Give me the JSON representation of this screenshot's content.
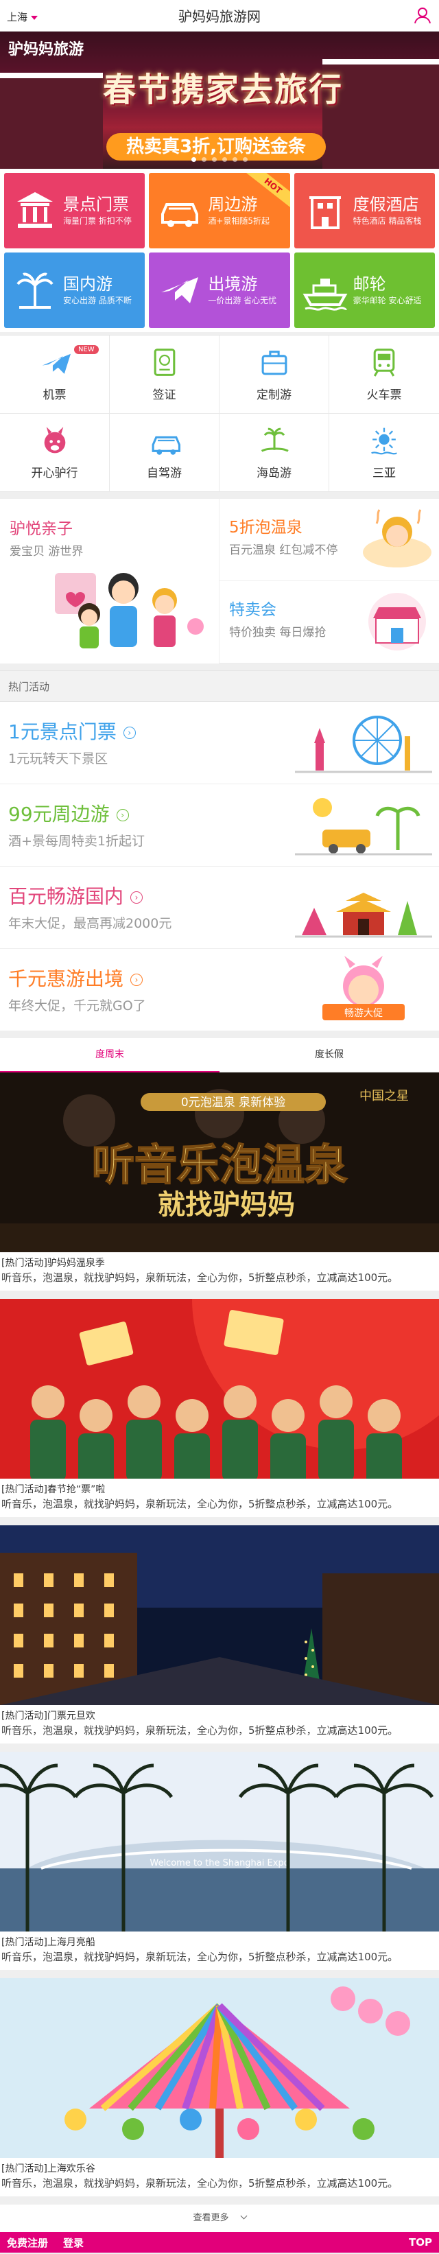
{
  "header": {
    "city": "上海",
    "title": "驴妈妈旅游网"
  },
  "banner": {
    "logo": "驴妈妈旅游",
    "headline": "春节携家去旅行",
    "ribbon": "热卖真3折,订购送金条"
  },
  "tiles": [
    {
      "title": "景点门票",
      "sub": "海量门票 折扣不停",
      "color": "#e93e68",
      "icon": "temple-icon"
    },
    {
      "title": "周边游",
      "sub": "酒+景相随5折起",
      "color": "#ff7d26",
      "icon": "car-icon",
      "badge": "HOT"
    },
    {
      "title": "度假酒店",
      "sub": "特色酒店 精品客栈",
      "color": "#f0554b",
      "icon": "hotel-icon"
    },
    {
      "title": "国内游",
      "sub": "安心出游 品质不断",
      "color": "#3f9ae6",
      "icon": "palm-icon"
    },
    {
      "title": "出境游",
      "sub": "一价出游 省心无忧",
      "color": "#b352d8",
      "icon": "plane-icon"
    },
    {
      "title": "邮轮",
      "sub": "豪华邮轮 安心舒适",
      "color": "#6ec031",
      "icon": "ship-icon"
    }
  ],
  "menu": [
    {
      "label": "机票",
      "icon": "plane-icon",
      "color": "#47a5ef",
      "badge": "NEW"
    },
    {
      "label": "签证",
      "icon": "visa-icon",
      "color": "#6ebf3b"
    },
    {
      "label": "定制游",
      "icon": "suitcase-icon",
      "color": "#3fa2ea"
    },
    {
      "label": "火车票",
      "icon": "train-icon",
      "color": "#6ebf3b"
    },
    {
      "label": "开心驴行",
      "icon": "donkey-icon",
      "color": "#e2457a"
    },
    {
      "label": "自驾游",
      "icon": "car-icon",
      "color": "#3fa2ea"
    },
    {
      "label": "海岛游",
      "icon": "island-icon",
      "color": "#6ebf3b"
    },
    {
      "label": "三亚",
      "icon": "sun-icon",
      "color": "#3fa2ea"
    }
  ],
  "promo": {
    "big": {
      "title": "驴悦亲子",
      "sub1": "爱宝贝",
      "sub2": "游世界",
      "color": "#e2457a"
    },
    "smalls": [
      {
        "title": "5折泡温泉",
        "sub": "百元温泉 红包减不停",
        "color": "#ff7d26"
      },
      {
        "title": "特卖会",
        "sub": "特价独卖 每日爆抢",
        "color": "#3fa2ea"
      }
    ]
  },
  "hot": {
    "header": "热门活动",
    "items": [
      {
        "title": "1元景点门票",
        "sub": "1元玩转天下景区",
        "color": "#3fa2ea"
      },
      {
        "title": "99元周边游",
        "sub": "酒+景每周特卖1折起订",
        "color": "#6ebf3b"
      },
      {
        "title": "百元畅游国内",
        "sub": "年末大促，最高再减2000元",
        "color": "#e2457a"
      },
      {
        "title": "千元惠游出境",
        "sub": "年终大促，千元就GO了",
        "color": "#ff7d26"
      }
    ],
    "art_caption": "畅游大促"
  },
  "tabs": [
    "度周末",
    "度长假"
  ],
  "feed": [
    {
      "title": "[热门活动]驴妈妈温泉季",
      "desc": "听音乐，泡温泉，就找驴妈妈，泉新玩法，全心为你，5折整点秒杀，立减高达100元。",
      "img_headline": "听音乐泡温泉",
      "img_sub": "就找驴妈妈",
      "img_pill": "0元泡温泉 泉新体验",
      "img_logo": "中国之星"
    },
    {
      "title": "[热门活动]春节抢“票”啦",
      "desc": "听音乐，泡温泉，就找驴妈妈，泉新玩法，全心为你，5折整点秒杀，立减高达100元。"
    },
    {
      "title": "[热门活动]门票元旦欢",
      "desc": "听音乐，泡温泉，就找驴妈妈，泉新玩法，全心为你，5折整点秒杀，立减高达100元。"
    },
    {
      "title": "[热门活动]上海月亮船",
      "desc": "听音乐，泡温泉，就找驴妈妈，泉新玩法，全心为你，5折整点秒杀，立减高达100元。",
      "img_sign": "Welcome to the Shanghai Expo"
    },
    {
      "title": "[热门活动]上海欢乐谷",
      "desc": "听音乐，泡温泉，就找驴妈妈，泉新玩法，全心为你，5折整点秒杀，立减高达100元。"
    }
  ],
  "more": "查看更多",
  "footer": {
    "register": "免费注册",
    "login": "登录",
    "top": "TOP"
  }
}
